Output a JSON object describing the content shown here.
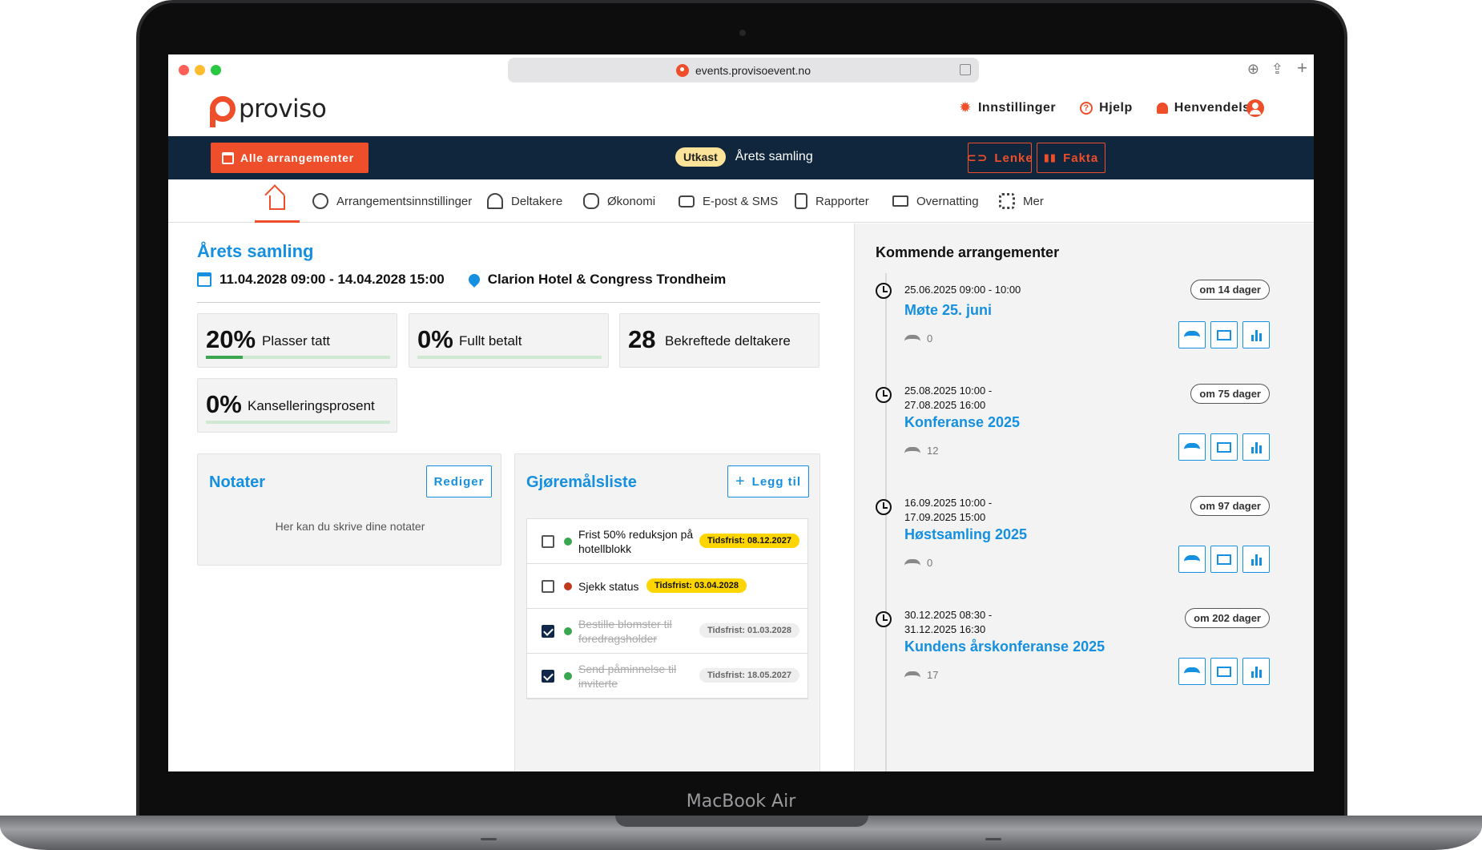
{
  "device": {
    "label": "MacBook Air"
  },
  "browser": {
    "url": "events.provisoevent.no"
  },
  "header": {
    "logo_text": "proviso",
    "links": [
      {
        "label": "Innstillinger",
        "icon": "gear-icon"
      },
      {
        "label": "Hjelp",
        "icon": "help-icon"
      },
      {
        "label": "Henvendelse",
        "icon": "bell-icon"
      }
    ]
  },
  "eventbar": {
    "all_events_label": "Alle arrangementer",
    "status_badge": "Utkast",
    "event_name": "Årets samling",
    "link_label": "Lenke",
    "facts_label": "Fakta"
  },
  "tabs": [
    {
      "label": "",
      "icon": "home-icon"
    },
    {
      "label": "Arrangementsinnstillinger",
      "icon": "calendar-clock-icon"
    },
    {
      "label": "Deltakere",
      "icon": "people-icon"
    },
    {
      "label": "Økonomi",
      "icon": "coins-icon"
    },
    {
      "label": "E-post & SMS",
      "icon": "mail-icon"
    },
    {
      "label": "Rapporter",
      "icon": "document-icon"
    },
    {
      "label": "Overnatting",
      "icon": "bed-icon"
    },
    {
      "label": "Mer",
      "icon": "grid-icon"
    }
  ],
  "event": {
    "title": "Årets samling",
    "dates": "11.04.2028 09:00 - 14.04.2028 15:00",
    "venue": "Clarion Hotel & Congress Trondheim"
  },
  "stats": [
    {
      "value": "20%",
      "label": "Plasser tatt",
      "progress": 0.2
    },
    {
      "value": "0%",
      "label": "Fullt betalt",
      "progress": 0
    },
    {
      "value": "28",
      "label": "Bekreftede deltakere"
    },
    {
      "value": "0%",
      "label": "Kanselleringsprosent",
      "progress": 0
    }
  ],
  "notes": {
    "title": "Notater",
    "edit_label": "Rediger",
    "placeholder": "Her kan du skrive dine notater"
  },
  "todo": {
    "title": "Gjøremålsliste",
    "add_label": "Legg til",
    "items": [
      {
        "text": "Frist 50% reduksjon på hotellblokk",
        "deadline": "Tidsfrist: 08.12.2027",
        "done": false,
        "status_color": "#3aa64f"
      },
      {
        "text": "Sjekk status",
        "deadline": "Tidsfrist: 03.04.2028",
        "done": false,
        "status_color": "#c0391b"
      },
      {
        "text": "Bestille blomster til foredragsholder",
        "deadline": "Tidsfrist: 01.03.2028",
        "done": true,
        "status_color": "#3aa64f"
      },
      {
        "text": "Send påminnelse til inviterte",
        "deadline": "Tidsfrist: 18.05.2027",
        "done": true,
        "status_color": "#3aa64f"
      }
    ]
  },
  "upcoming": {
    "title": "Kommende arrangementer",
    "events": [
      {
        "datetime": "25.06.2025 09:00 - 10:00",
        "countdown": "om 14 dager",
        "name": "Møte 25. juni",
        "participants": "0"
      },
      {
        "datetime": "25.08.2025 10:00 - 27.08.2025 16:00",
        "countdown": "om 75 dager",
        "name": "Konferanse 2025",
        "participants": "12"
      },
      {
        "datetime": "16.09.2025 10:00 - 17.09.2025 15:00",
        "countdown": "om 97 dager",
        "name": "Høstsamling 2025",
        "participants": "0"
      },
      {
        "datetime": "30.12.2025 08:30 - 31.12.2025 16:30",
        "countdown": "om 202 dager",
        "name": "Kundens årskonferanse 2025",
        "participants": "17"
      }
    ]
  },
  "colors": {
    "brand_orange": "#ee4e2a",
    "navy": "#10263d",
    "link_blue": "#1590e0",
    "progress_green": "#3aa64f",
    "deadline_yellow": "#ffd500"
  }
}
